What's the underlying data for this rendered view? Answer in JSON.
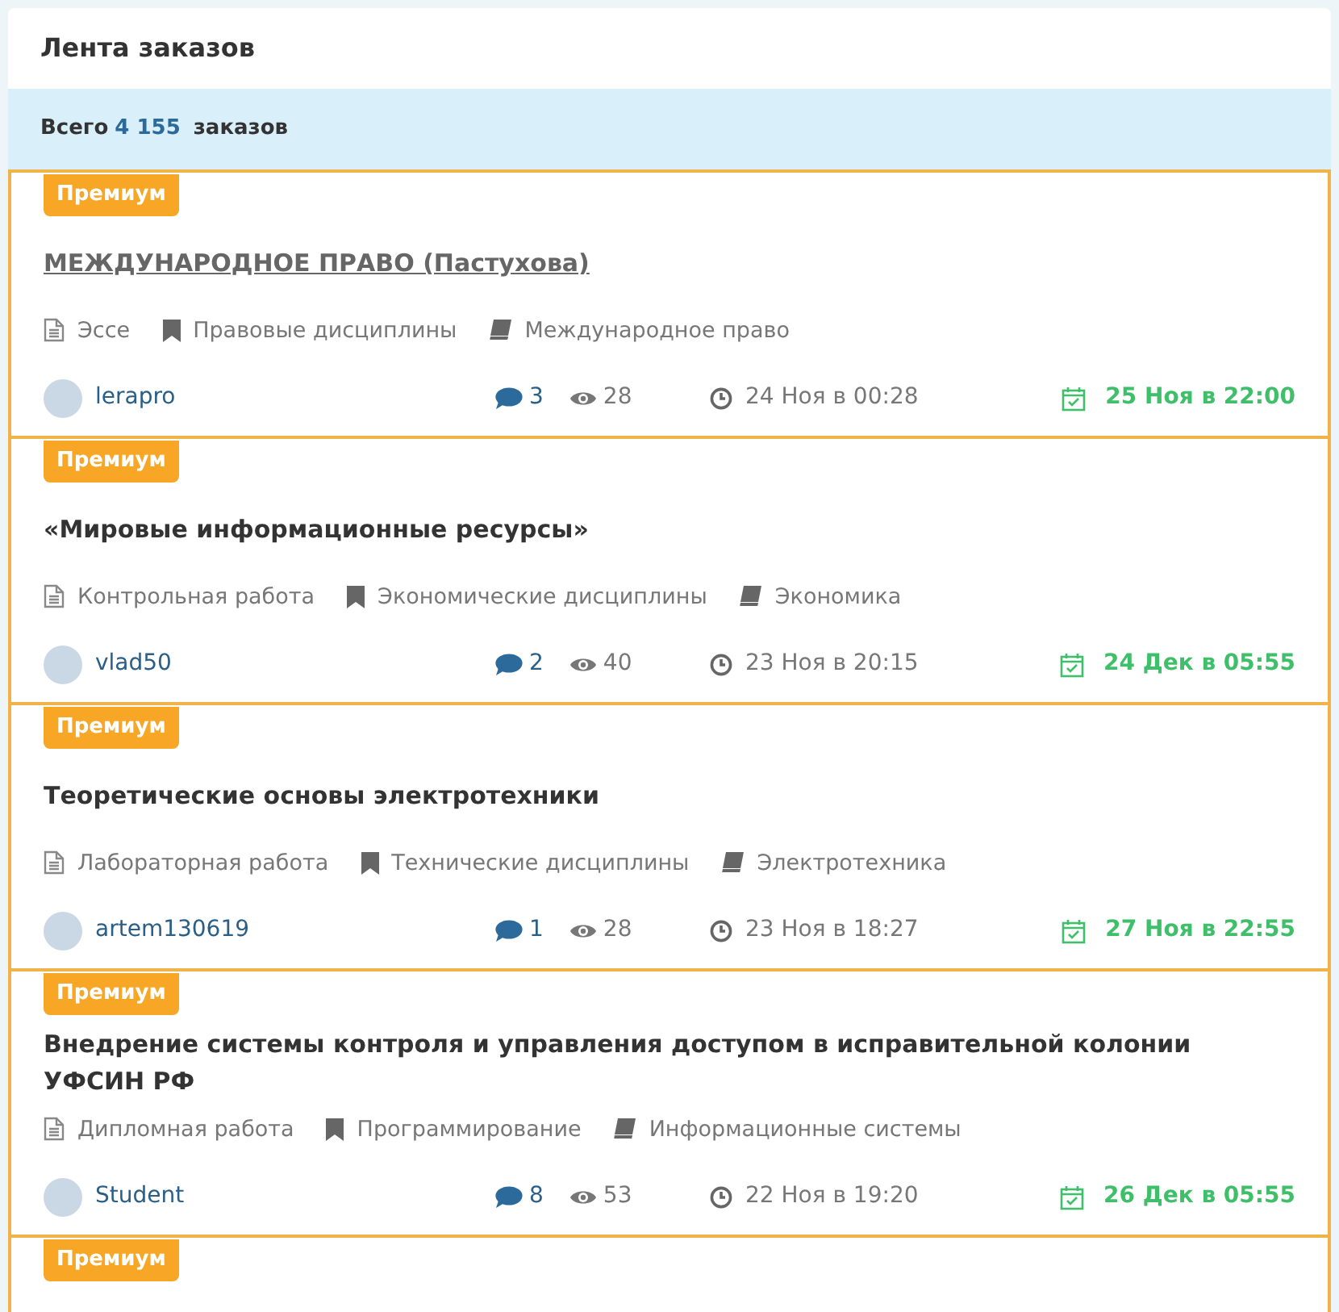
{
  "header": {
    "title": "Лента заказов"
  },
  "summary": {
    "prefix": "Всего",
    "count": "4 155",
    "suffix": "заказов"
  },
  "orders": [
    {
      "badge": "Премиум",
      "title": "МЕЖДУНАРОДНОЕ ПРАВО (Пастухова)",
      "visited": true,
      "type": "Эссе",
      "category": "Правовые дисциплины",
      "subject": "Международное право",
      "user": "lerapro",
      "comments": "3",
      "views": "28",
      "created": "24 Ноя в 00:28",
      "deadline": "25 Ноя в 22:00"
    },
    {
      "badge": "Премиум",
      "title": "«Мировые информационные ресурсы»",
      "visited": false,
      "type": "Контрольная работа",
      "category": "Экономические дисциплины",
      "subject": "Экономика",
      "user": "vlad50",
      "comments": "2",
      "views": "40",
      "created": "23 Ноя в 20:15",
      "deadline": "24 Дек в 05:55"
    },
    {
      "badge": "Премиум",
      "title": "Теоретические основы электротехники",
      "visited": false,
      "type": "Лабораторная работа",
      "category": "Технические дисциплины",
      "subject": "Электротехника",
      "user": "artem130619",
      "comments": "1",
      "views": "28",
      "created": "23 Ноя в 18:27",
      "deadline": "27 Ноя в 22:55"
    },
    {
      "badge": "Премиум",
      "title": "Внедрение системы контроля и управления доступом в исправительной колонии УФСИН РФ",
      "visited": false,
      "type": "Дипломная работа",
      "category": "Программирование",
      "subject": "Информационные системы",
      "user": "Student",
      "comments": "8",
      "views": "53",
      "created": "22 Ноя в 19:20",
      "deadline": "26 Дек в 05:55"
    },
    {
      "badge": "Премиум"
    }
  ]
}
